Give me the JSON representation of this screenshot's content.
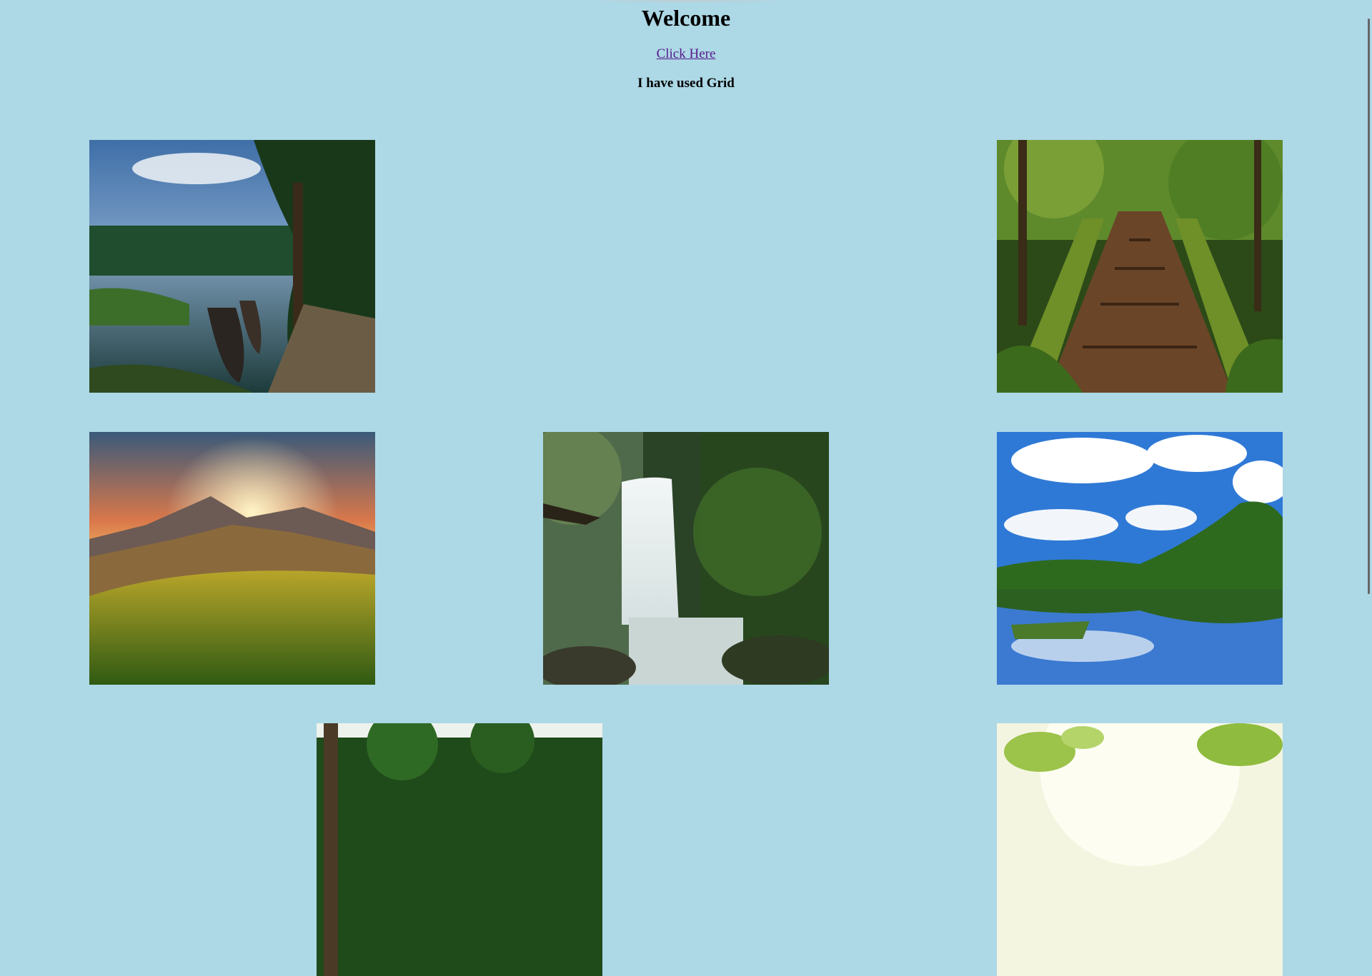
{
  "page": {
    "title": "Welcome",
    "link_text": "Click Here",
    "subtitle": "I have used Grid"
  },
  "colors": {
    "background": "#add8e6",
    "link": "#551a8b"
  },
  "gallery": {
    "images": [
      {
        "name": "backwater-canoes-image"
      },
      {
        "name": "mossy-forest-boardwalk-image"
      },
      {
        "name": "mountain-sunset-meadow-image"
      },
      {
        "name": "jungle-waterfall-image"
      },
      {
        "name": "blue-sky-lake-reflection-image"
      },
      {
        "name": "tropical-palms-image"
      },
      {
        "name": "sunlit-leaves-image"
      }
    ]
  }
}
